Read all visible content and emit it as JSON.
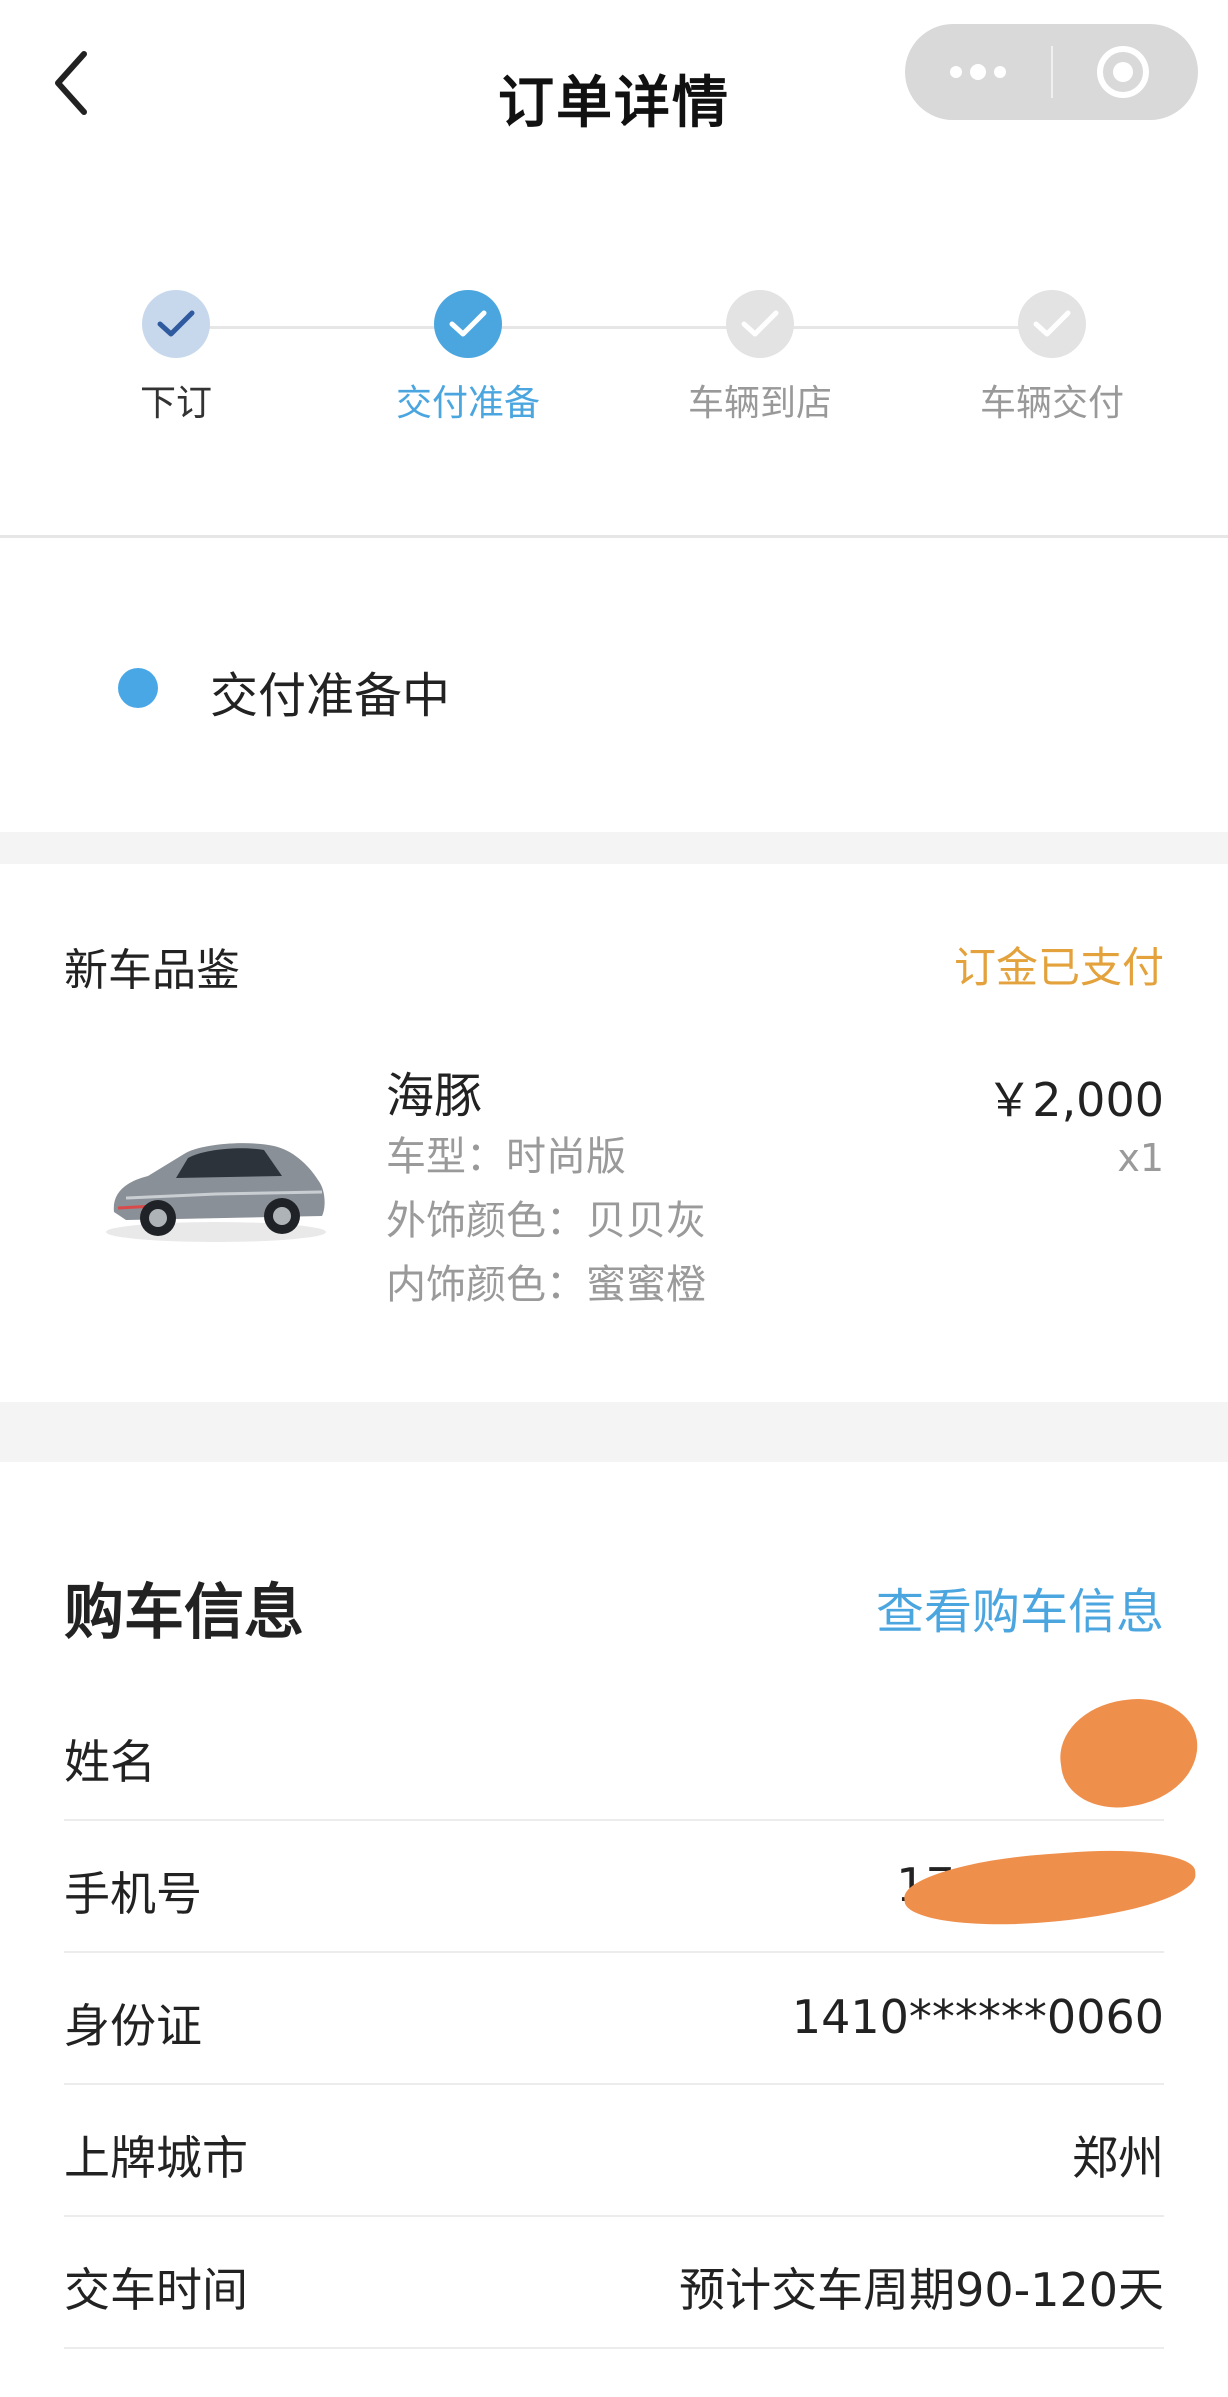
{
  "header": {
    "title": "订单详情"
  },
  "steps": [
    {
      "label": "下订",
      "state": "done"
    },
    {
      "label": "交付准备",
      "state": "active"
    },
    {
      "label": "车辆到店",
      "state": "todo"
    },
    {
      "label": "车辆交付",
      "state": "todo"
    }
  ],
  "status": {
    "text": "交付准备中",
    "color": "#4aa7e6"
  },
  "product_card": {
    "title": "新车品鉴",
    "badge": "订金已支付",
    "name": "海豚",
    "model": "车型：时尚版",
    "exterior": "外饰颜色：贝贝灰",
    "interior": "内饰颜色：蜜蜜橙",
    "price": "￥2,000",
    "qty": "x1"
  },
  "purchase_info": {
    "title": "购车信息",
    "link": "查看购车信息",
    "rows": [
      {
        "key": "姓名",
        "value": ""
      },
      {
        "key": "手机号",
        "value": "170"
      },
      {
        "key": "身份证",
        "value": "1410******0060"
      },
      {
        "key": "上牌城市",
        "value": "郑州"
      },
      {
        "key": "交车时间",
        "value": "预计交车周期90-120天"
      }
    ]
  },
  "colors": {
    "accent": "#4ba6e0",
    "badge": "#e3a23c",
    "redaction": "#ef8f4c"
  }
}
